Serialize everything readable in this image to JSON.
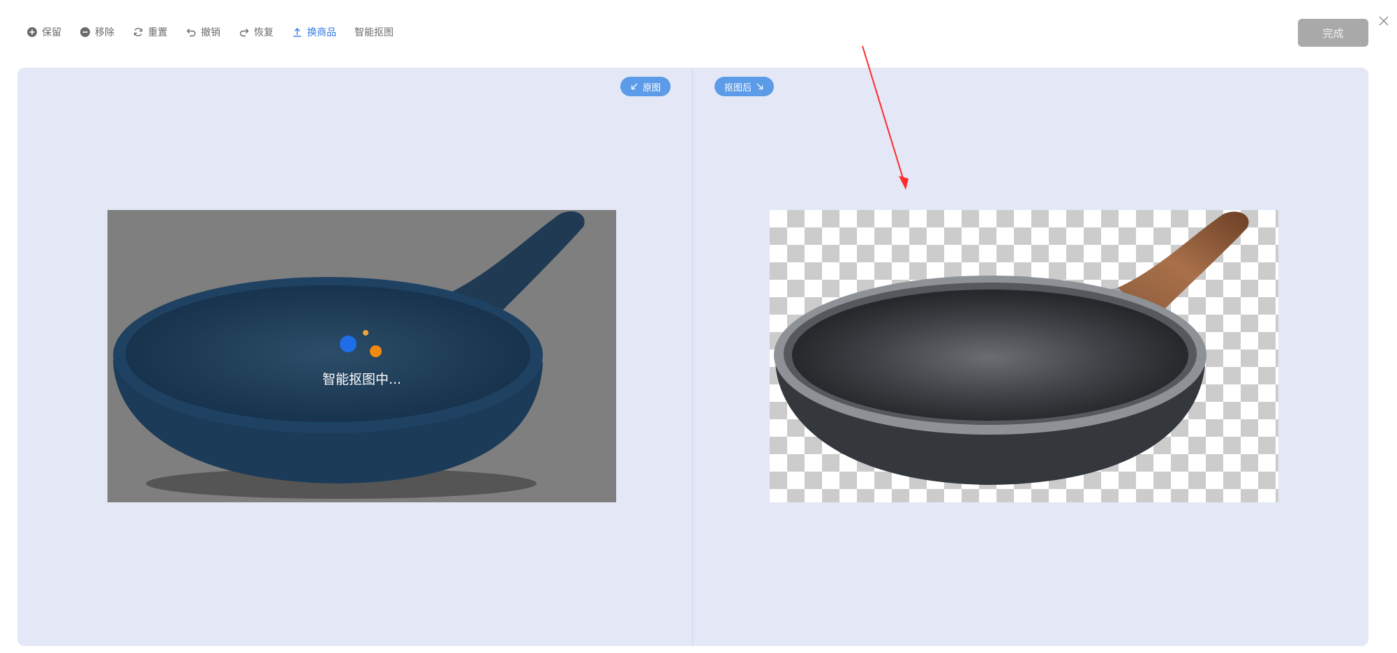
{
  "toolbar": {
    "items": [
      {
        "label": "保留",
        "icon": "plus-circle-icon"
      },
      {
        "label": "移除",
        "icon": "minus-circle-icon"
      },
      {
        "label": "重置",
        "icon": "refresh-icon"
      },
      {
        "label": "撤销",
        "icon": "undo-icon"
      },
      {
        "label": "恢复",
        "icon": "redo-icon"
      },
      {
        "label": "换商品",
        "icon": "upload-icon",
        "active": true
      },
      {
        "label": "智能抠图",
        "icon": ""
      }
    ],
    "done_label": "完成",
    "close_icon": "close-icon"
  },
  "canvas": {
    "original_tag": "原图",
    "cutout_tag": "抠图后",
    "loading_text": "智能抠图中...",
    "colors": {
      "accent": "#2e7be6",
      "tag": "#5b9be8",
      "workspace": "#e4e8f6",
      "done_disabled": "#a9a9a9",
      "loading_blue": "#1e6ee8",
      "loading_orange": "#f28a12",
      "annotation_arrow": "#ff2a2a"
    }
  }
}
